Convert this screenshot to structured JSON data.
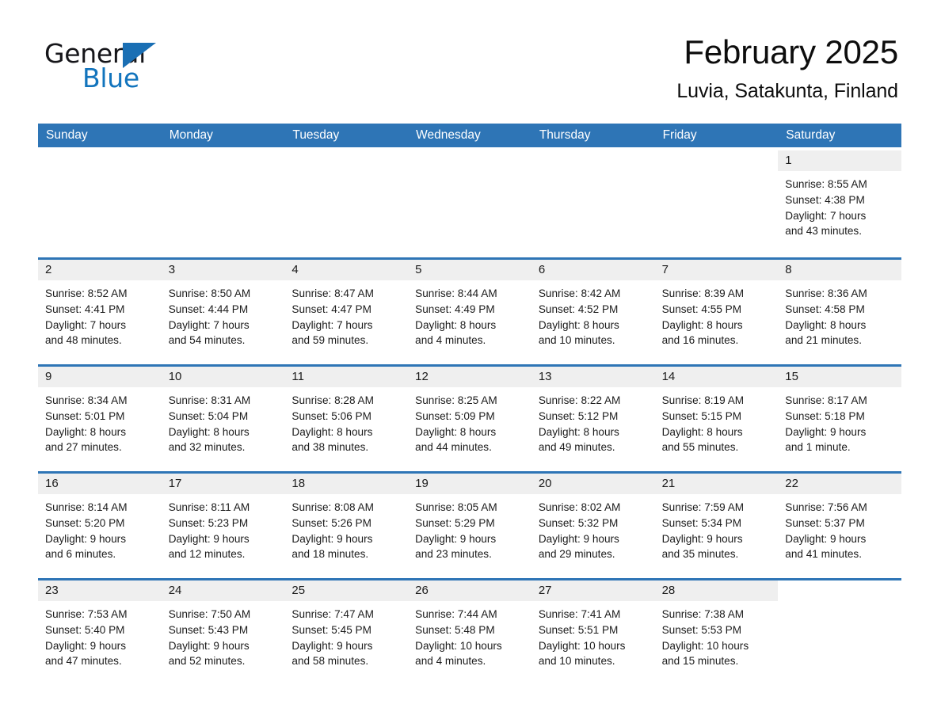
{
  "brand": {
    "name_part1": "General",
    "name_part2": "Blue",
    "logo_icon": "blue-triangle-icon",
    "accent_color": "#1a6fb4"
  },
  "header": {
    "month_title": "February 2025",
    "location": "Luvia, Satakunta, Finland"
  },
  "calendar": {
    "header_color": "#2E75B6",
    "weekdays": [
      "Sunday",
      "Monday",
      "Tuesday",
      "Wednesday",
      "Thursday",
      "Friday",
      "Saturday"
    ],
    "weeks": [
      [
        {
          "date": "",
          "lines": []
        },
        {
          "date": "",
          "lines": []
        },
        {
          "date": "",
          "lines": []
        },
        {
          "date": "",
          "lines": []
        },
        {
          "date": "",
          "lines": []
        },
        {
          "date": "",
          "lines": []
        },
        {
          "date": "1",
          "lines": [
            "Sunrise: 8:55 AM",
            "Sunset: 4:38 PM",
            "Daylight: 7 hours",
            "and 43 minutes."
          ]
        }
      ],
      [
        {
          "date": "2",
          "lines": [
            "Sunrise: 8:52 AM",
            "Sunset: 4:41 PM",
            "Daylight: 7 hours",
            "and 48 minutes."
          ]
        },
        {
          "date": "3",
          "lines": [
            "Sunrise: 8:50 AM",
            "Sunset: 4:44 PM",
            "Daylight: 7 hours",
            "and 54 minutes."
          ]
        },
        {
          "date": "4",
          "lines": [
            "Sunrise: 8:47 AM",
            "Sunset: 4:47 PM",
            "Daylight: 7 hours",
            "and 59 minutes."
          ]
        },
        {
          "date": "5",
          "lines": [
            "Sunrise: 8:44 AM",
            "Sunset: 4:49 PM",
            "Daylight: 8 hours",
            "and 4 minutes."
          ]
        },
        {
          "date": "6",
          "lines": [
            "Sunrise: 8:42 AM",
            "Sunset: 4:52 PM",
            "Daylight: 8 hours",
            "and 10 minutes."
          ]
        },
        {
          "date": "7",
          "lines": [
            "Sunrise: 8:39 AM",
            "Sunset: 4:55 PM",
            "Daylight: 8 hours",
            "and 16 minutes."
          ]
        },
        {
          "date": "8",
          "lines": [
            "Sunrise: 8:36 AM",
            "Sunset: 4:58 PM",
            "Daylight: 8 hours",
            "and 21 minutes."
          ]
        }
      ],
      [
        {
          "date": "9",
          "lines": [
            "Sunrise: 8:34 AM",
            "Sunset: 5:01 PM",
            "Daylight: 8 hours",
            "and 27 minutes."
          ]
        },
        {
          "date": "10",
          "lines": [
            "Sunrise: 8:31 AM",
            "Sunset: 5:04 PM",
            "Daylight: 8 hours",
            "and 32 minutes."
          ]
        },
        {
          "date": "11",
          "lines": [
            "Sunrise: 8:28 AM",
            "Sunset: 5:06 PM",
            "Daylight: 8 hours",
            "and 38 minutes."
          ]
        },
        {
          "date": "12",
          "lines": [
            "Sunrise: 8:25 AM",
            "Sunset: 5:09 PM",
            "Daylight: 8 hours",
            "and 44 minutes."
          ]
        },
        {
          "date": "13",
          "lines": [
            "Sunrise: 8:22 AM",
            "Sunset: 5:12 PM",
            "Daylight: 8 hours",
            "and 49 minutes."
          ]
        },
        {
          "date": "14",
          "lines": [
            "Sunrise: 8:19 AM",
            "Sunset: 5:15 PM",
            "Daylight: 8 hours",
            "and 55 minutes."
          ]
        },
        {
          "date": "15",
          "lines": [
            "Sunrise: 8:17 AM",
            "Sunset: 5:18 PM",
            "Daylight: 9 hours",
            "and 1 minute."
          ]
        }
      ],
      [
        {
          "date": "16",
          "lines": [
            "Sunrise: 8:14 AM",
            "Sunset: 5:20 PM",
            "Daylight: 9 hours",
            "and 6 minutes."
          ]
        },
        {
          "date": "17",
          "lines": [
            "Sunrise: 8:11 AM",
            "Sunset: 5:23 PM",
            "Daylight: 9 hours",
            "and 12 minutes."
          ]
        },
        {
          "date": "18",
          "lines": [
            "Sunrise: 8:08 AM",
            "Sunset: 5:26 PM",
            "Daylight: 9 hours",
            "and 18 minutes."
          ]
        },
        {
          "date": "19",
          "lines": [
            "Sunrise: 8:05 AM",
            "Sunset: 5:29 PM",
            "Daylight: 9 hours",
            "and 23 minutes."
          ]
        },
        {
          "date": "20",
          "lines": [
            "Sunrise: 8:02 AM",
            "Sunset: 5:32 PM",
            "Daylight: 9 hours",
            "and 29 minutes."
          ]
        },
        {
          "date": "21",
          "lines": [
            "Sunrise: 7:59 AM",
            "Sunset: 5:34 PM",
            "Daylight: 9 hours",
            "and 35 minutes."
          ]
        },
        {
          "date": "22",
          "lines": [
            "Sunrise: 7:56 AM",
            "Sunset: 5:37 PM",
            "Daylight: 9 hours",
            "and 41 minutes."
          ]
        }
      ],
      [
        {
          "date": "23",
          "lines": [
            "Sunrise: 7:53 AM",
            "Sunset: 5:40 PM",
            "Daylight: 9 hours",
            "and 47 minutes."
          ]
        },
        {
          "date": "24",
          "lines": [
            "Sunrise: 7:50 AM",
            "Sunset: 5:43 PM",
            "Daylight: 9 hours",
            "and 52 minutes."
          ]
        },
        {
          "date": "25",
          "lines": [
            "Sunrise: 7:47 AM",
            "Sunset: 5:45 PM",
            "Daylight: 9 hours",
            "and 58 minutes."
          ]
        },
        {
          "date": "26",
          "lines": [
            "Sunrise: 7:44 AM",
            "Sunset: 5:48 PM",
            "Daylight: 10 hours",
            "and 4 minutes."
          ]
        },
        {
          "date": "27",
          "lines": [
            "Sunrise: 7:41 AM",
            "Sunset: 5:51 PM",
            "Daylight: 10 hours",
            "and 10 minutes."
          ]
        },
        {
          "date": "28",
          "lines": [
            "Sunrise: 7:38 AM",
            "Sunset: 5:53 PM",
            "Daylight: 10 hours",
            "and 15 minutes."
          ]
        },
        {
          "date": "",
          "lines": []
        }
      ]
    ]
  }
}
